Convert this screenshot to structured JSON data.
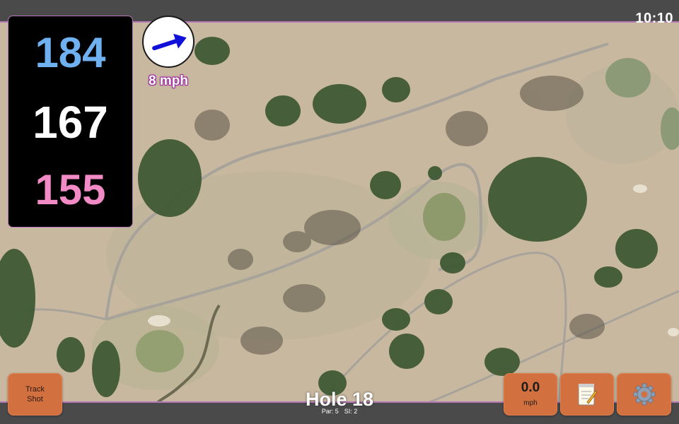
{
  "status": {
    "time": "10:10"
  },
  "distances": {
    "back": "184",
    "middle": "167",
    "front": "155"
  },
  "wind": {
    "speed": "8 mph",
    "icon": "arrow-icon",
    "direction": "east-northeast"
  },
  "hole": {
    "title": "Hole 18",
    "par": "Par: 5",
    "si": "SI: 2"
  },
  "buttons": {
    "track_shot_line1": "Track",
    "track_shot_line2": "Shot",
    "speed_value": "0.0",
    "speed_unit": "mph",
    "notes_icon": "notepad-icon",
    "settings_icon": "gear-icon"
  },
  "colors": {
    "back": "#6fb0f0",
    "middle": "#ffffff",
    "front": "#f28ac6",
    "button": "#d2703f",
    "accent_border": "#b678b6"
  }
}
